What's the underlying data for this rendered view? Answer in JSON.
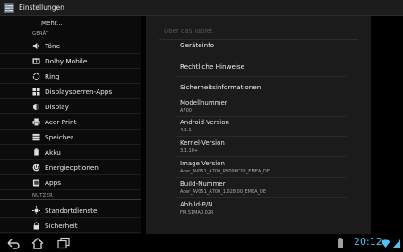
{
  "app": {
    "title": "Einstellungen"
  },
  "sidebar": {
    "more_label": "Mehr...",
    "section_device": "GERÄT",
    "section_user": "NUTZER",
    "items": [
      {
        "label": "Töne",
        "icon": "volume-icon"
      },
      {
        "label": "Dolby Mobile",
        "icon": "dolby-icon"
      },
      {
        "label": "Ring",
        "icon": "ring-icon"
      },
      {
        "label": "Displaysperren-Apps",
        "icon": "lockscreen-apps-icon"
      },
      {
        "label": "Display",
        "icon": "display-icon"
      },
      {
        "label": "Acer Print",
        "icon": "printer-icon"
      },
      {
        "label": "Speicher",
        "icon": "storage-icon"
      },
      {
        "label": "Akku",
        "icon": "battery-icon"
      },
      {
        "label": "Energieoptionen",
        "icon": "power-icon"
      },
      {
        "label": "Apps",
        "icon": "apps-icon"
      }
    ],
    "user_items": [
      {
        "label": "Standortdienste",
        "icon": "location-icon"
      },
      {
        "label": "Sicherheit",
        "icon": "lock-icon"
      }
    ]
  },
  "about": {
    "title": "Über das Tablet",
    "links": [
      "Geräteinfo",
      "Rechtliche Hinweise",
      "Sicherheitsinformationen"
    ],
    "props": [
      {
        "title": "Modellnummer",
        "value": "A700"
      },
      {
        "title": "Android-Version",
        "value": "4.1.1"
      },
      {
        "title": "Kernel-Version",
        "value": "3.1.10+"
      },
      {
        "title": "Image Version",
        "value": "Acer_AV051_A700_RV09RC02_EMEA_DE"
      },
      {
        "title": "Build-Nummer",
        "value": "Acer_AV051_A700_1.028.00_EMEA_DE"
      },
      {
        "title": "Abbild-P/N",
        "value": "FM.S1MA0.02R"
      }
    ]
  },
  "statusbar": {
    "time": "20:12"
  },
  "colors": {
    "accent": "#4fc3f7",
    "pane": "#1b1b1b",
    "background": "#000000"
  }
}
